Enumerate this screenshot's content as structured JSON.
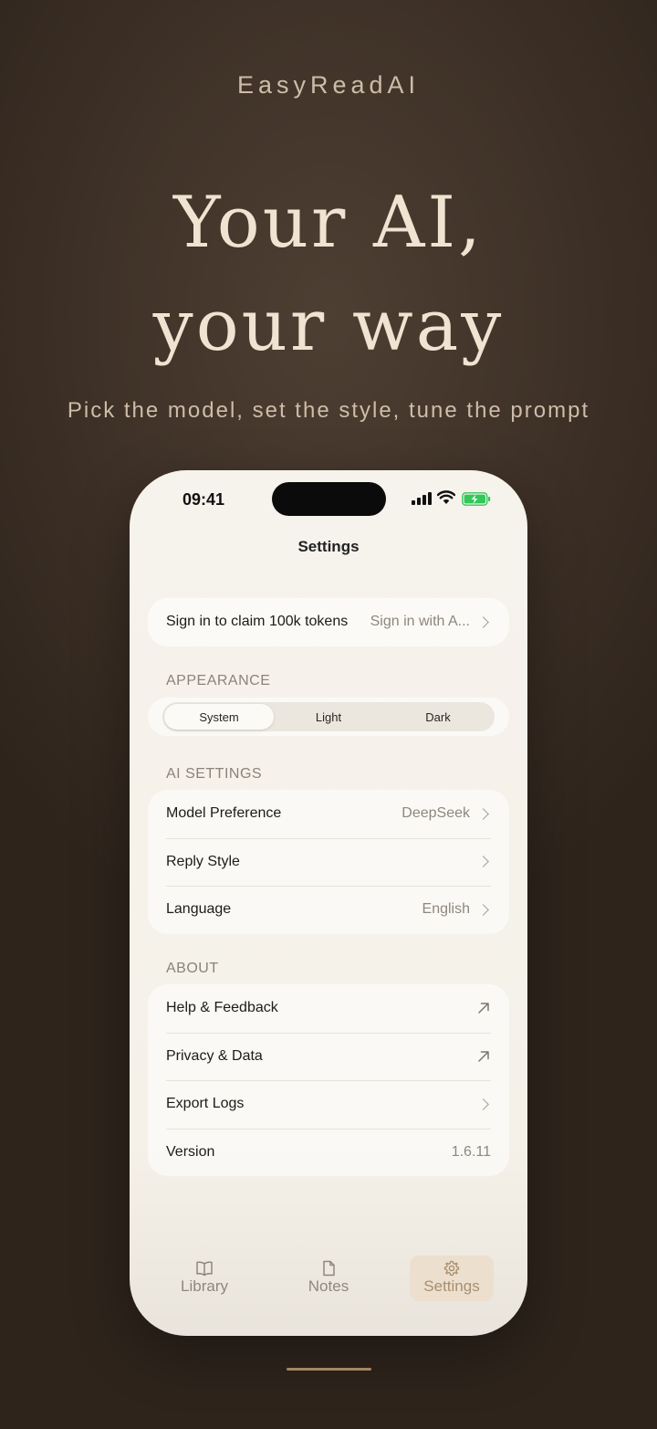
{
  "brand": "EasyReadAI",
  "headline": {
    "line1": "Your AI,",
    "line2": "your way"
  },
  "subtitle": "Pick the model, set the style, tune the prompt",
  "phone": {
    "status_time": "09:41",
    "nav_title": "Settings",
    "signin": {
      "label": "Sign in to claim 100k tokens",
      "value": "Sign in with A..."
    },
    "appearance": {
      "header": "APPEARANCE",
      "options": [
        "System",
        "Light",
        "Dark"
      ],
      "selected": "System"
    },
    "ai_settings": {
      "header": "AI SETTINGS",
      "rows": [
        {
          "label": "Model Preference",
          "value": "DeepSeek"
        },
        {
          "label": "Reply Style",
          "value": ""
        },
        {
          "label": "Language",
          "value": "English"
        }
      ]
    },
    "about": {
      "header": "ABOUT",
      "rows": [
        {
          "label": "Help & Feedback"
        },
        {
          "label": "Privacy & Data"
        },
        {
          "label": "Export Logs"
        },
        {
          "label": "Version",
          "value": "1.6.11"
        }
      ]
    },
    "tabs": [
      {
        "label": "Library",
        "icon": "book-icon"
      },
      {
        "label": "Notes",
        "icon": "document-icon"
      },
      {
        "label": "Settings",
        "icon": "gear-icon"
      }
    ],
    "active_tab": "Settings"
  },
  "colors": {
    "background": "#3d3026",
    "accent": "#a88f6f",
    "phone_bg": "#f6f3ec",
    "battery": "#34c759"
  }
}
